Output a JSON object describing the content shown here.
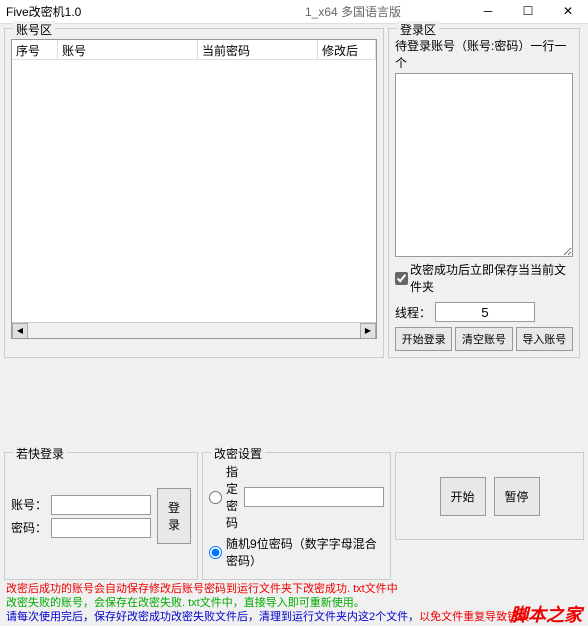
{
  "titlebar": {
    "title": "Five改密机1.0",
    "fragment": "1_x64 多国语言版"
  },
  "account_area": {
    "group_label": "账号区",
    "columns": {
      "seq": "序号",
      "account": "账号",
      "current_pw": "当前密码",
      "new_pw": "修改后"
    }
  },
  "quick_login": {
    "group_label": "若快登录",
    "account_label": "账号：",
    "password_label": "密码：",
    "account_value": "",
    "password_value": "",
    "login_btn": "登录"
  },
  "login_area": {
    "group_label": "登录区",
    "pending_label": "待登录账号（账号:密码）一行一个",
    "checkbox_label": "改密成功后立即保存当当前文件夹",
    "thread_label": "线程：",
    "thread_value": "5",
    "start_login": "开始登录",
    "clear_accounts": "清空账号",
    "import_accounts": "导入账号"
  },
  "pw_settings": {
    "group_label": "改密设置",
    "specified_label": "指定密码",
    "specified_value": "",
    "random_label": "随机9位密码（数字字母混合密码）"
  },
  "actions": {
    "start": "开始",
    "pause": "暂停"
  },
  "footer": {
    "line1a": "改密后成功的账号会自动保存修改后账号密码到运行文件夹下改密成功. txt文件中",
    "line2a": "改密失败的账号，会保存在改密失败. txt文件中，直接导入即可重新使用。",
    "line3a": "请每次使用完后，保存好改密成功改密失败文件后，清理到运行文件夹内这2个文件，",
    "line3b": "以免文件重复导致错误",
    "watermark": "脚本之家"
  }
}
